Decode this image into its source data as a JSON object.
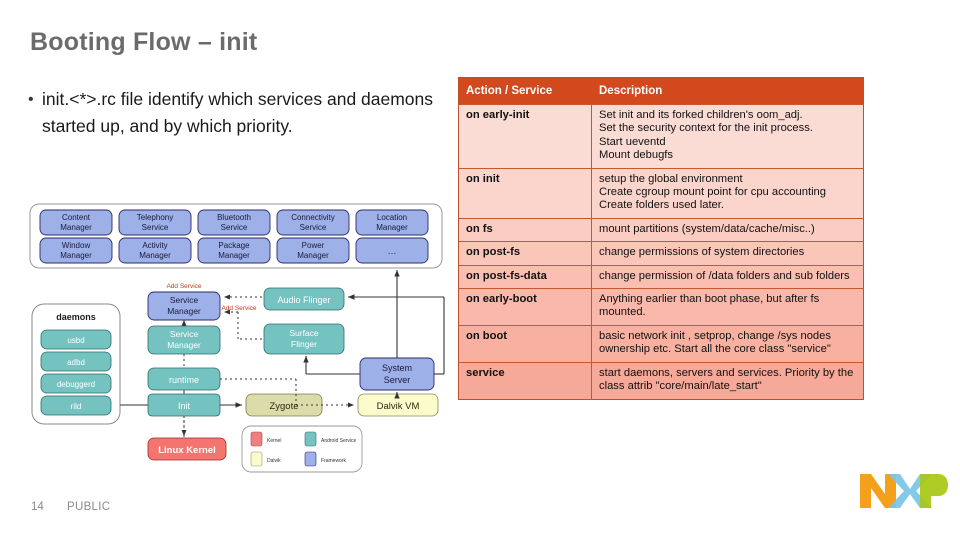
{
  "slide": {
    "title": "Booting Flow – init",
    "bullets": [
      "init.<*>.rc file identify which services and daemons started up, and by which priority."
    ]
  },
  "footer": {
    "page_number": "14",
    "classification": "PUBLIC",
    "logo_text": "NXP",
    "logo_colors": {
      "n": "#f5a01a",
      "x": "#78c4e8",
      "p": "#a8c814"
    }
  },
  "table": {
    "headers": [
      "Action / Service",
      "Description"
    ],
    "header_bg": "#d2491e",
    "rows": [
      {
        "action": "on early-init",
        "description": [
          "Set init and its forked children's oom_adj.",
          "Set the security context for the init process.",
          "Start ueventd",
          "Mount debugfs"
        ]
      },
      {
        "action": "on init",
        "description": [
          "setup the global environment",
          "Create cgroup mount point for cpu accounting",
          "Create folders used later."
        ]
      },
      {
        "action": "on fs",
        "description": [
          "mount partitions (system/data/cache/misc..)"
        ]
      },
      {
        "action": "on post-fs",
        "description": [
          "change permissions of system directories"
        ]
      },
      {
        "action": "on post-fs-data",
        "description": [
          "change permission of /data folders and sub folders"
        ]
      },
      {
        "action": "on early-boot",
        "description": [
          "Anything earlier than boot phase, but after fs mounted."
        ]
      },
      {
        "action": "on boot",
        "description": [
          "basic network init , setprop, change /sys nodes ownership etc. Start all the core class \"service\""
        ]
      },
      {
        "action": "service",
        "description": [
          "start daemons, servers and services. Priority by the class attrib \"core/main/late_start\""
        ]
      }
    ]
  },
  "diagram": {
    "framework_services_row1": [
      "Content Manager",
      "Telephony Service",
      "Bluetooth Service",
      "Connectivity Service",
      "Location Manager"
    ],
    "framework_services_row2": [
      "Window Manager",
      "Activity Manager",
      "Package Manager",
      "Power Manager",
      "…"
    ],
    "daemons_title": "daemons",
    "daemons": [
      "usbd",
      "adbd",
      "debuggerd",
      "rild"
    ],
    "nodes": {
      "service_manager_top": "Service Manager",
      "service_manager_bottom": "Service Manager",
      "audio_flinger": "Audio Flinger",
      "surface_flinger": "Surface Flinger",
      "system_server": "System Server",
      "runtime": "runtime",
      "init": "Init",
      "zygote": "Zygote",
      "dalvik_vm": "Dalvik VM",
      "linux_kernel": "Linux Kernel"
    },
    "edge_labels": [
      "Add Service",
      "Add Service"
    ],
    "legend": [
      {
        "label": "Kernel",
        "color": "#f08080"
      },
      {
        "label": "Android Service",
        "color": "#74c3c0"
      },
      {
        "label": "Dalvik",
        "color": "#fbfbd0"
      },
      {
        "label": "Framework",
        "color": "#9db0e8"
      }
    ],
    "colors": {
      "kernel": "#f4756f",
      "android_service": "#74c3c0",
      "dalvik": "#fbfbcc",
      "framework": "#9db0e8",
      "zygote": "#dcdcab"
    }
  }
}
